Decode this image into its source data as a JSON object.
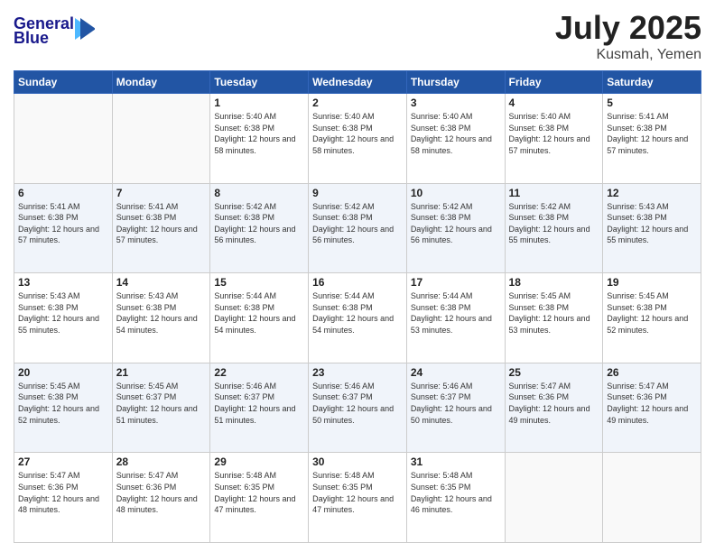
{
  "logo": {
    "line1": "General",
    "line2": "Blue",
    "icon": "▶"
  },
  "title": {
    "month": "July 2025",
    "location": "Kusmah, Yemen"
  },
  "days_of_week": [
    "Sunday",
    "Monday",
    "Tuesday",
    "Wednesday",
    "Thursday",
    "Friday",
    "Saturday"
  ],
  "weeks": [
    [
      {
        "day": "",
        "info": ""
      },
      {
        "day": "",
        "info": ""
      },
      {
        "day": "1",
        "info": "Sunrise: 5:40 AM\nSunset: 6:38 PM\nDaylight: 12 hours and 58 minutes."
      },
      {
        "day": "2",
        "info": "Sunrise: 5:40 AM\nSunset: 6:38 PM\nDaylight: 12 hours and 58 minutes."
      },
      {
        "day": "3",
        "info": "Sunrise: 5:40 AM\nSunset: 6:38 PM\nDaylight: 12 hours and 58 minutes."
      },
      {
        "day": "4",
        "info": "Sunrise: 5:40 AM\nSunset: 6:38 PM\nDaylight: 12 hours and 57 minutes."
      },
      {
        "day": "5",
        "info": "Sunrise: 5:41 AM\nSunset: 6:38 PM\nDaylight: 12 hours and 57 minutes."
      }
    ],
    [
      {
        "day": "6",
        "info": "Sunrise: 5:41 AM\nSunset: 6:38 PM\nDaylight: 12 hours and 57 minutes."
      },
      {
        "day": "7",
        "info": "Sunrise: 5:41 AM\nSunset: 6:38 PM\nDaylight: 12 hours and 57 minutes."
      },
      {
        "day": "8",
        "info": "Sunrise: 5:42 AM\nSunset: 6:38 PM\nDaylight: 12 hours and 56 minutes."
      },
      {
        "day": "9",
        "info": "Sunrise: 5:42 AM\nSunset: 6:38 PM\nDaylight: 12 hours and 56 minutes."
      },
      {
        "day": "10",
        "info": "Sunrise: 5:42 AM\nSunset: 6:38 PM\nDaylight: 12 hours and 56 minutes."
      },
      {
        "day": "11",
        "info": "Sunrise: 5:42 AM\nSunset: 6:38 PM\nDaylight: 12 hours and 55 minutes."
      },
      {
        "day": "12",
        "info": "Sunrise: 5:43 AM\nSunset: 6:38 PM\nDaylight: 12 hours and 55 minutes."
      }
    ],
    [
      {
        "day": "13",
        "info": "Sunrise: 5:43 AM\nSunset: 6:38 PM\nDaylight: 12 hours and 55 minutes."
      },
      {
        "day": "14",
        "info": "Sunrise: 5:43 AM\nSunset: 6:38 PM\nDaylight: 12 hours and 54 minutes."
      },
      {
        "day": "15",
        "info": "Sunrise: 5:44 AM\nSunset: 6:38 PM\nDaylight: 12 hours and 54 minutes."
      },
      {
        "day": "16",
        "info": "Sunrise: 5:44 AM\nSunset: 6:38 PM\nDaylight: 12 hours and 54 minutes."
      },
      {
        "day": "17",
        "info": "Sunrise: 5:44 AM\nSunset: 6:38 PM\nDaylight: 12 hours and 53 minutes."
      },
      {
        "day": "18",
        "info": "Sunrise: 5:45 AM\nSunset: 6:38 PM\nDaylight: 12 hours and 53 minutes."
      },
      {
        "day": "19",
        "info": "Sunrise: 5:45 AM\nSunset: 6:38 PM\nDaylight: 12 hours and 52 minutes."
      }
    ],
    [
      {
        "day": "20",
        "info": "Sunrise: 5:45 AM\nSunset: 6:38 PM\nDaylight: 12 hours and 52 minutes."
      },
      {
        "day": "21",
        "info": "Sunrise: 5:45 AM\nSunset: 6:37 PM\nDaylight: 12 hours and 51 minutes."
      },
      {
        "day": "22",
        "info": "Sunrise: 5:46 AM\nSunset: 6:37 PM\nDaylight: 12 hours and 51 minutes."
      },
      {
        "day": "23",
        "info": "Sunrise: 5:46 AM\nSunset: 6:37 PM\nDaylight: 12 hours and 50 minutes."
      },
      {
        "day": "24",
        "info": "Sunrise: 5:46 AM\nSunset: 6:37 PM\nDaylight: 12 hours and 50 minutes."
      },
      {
        "day": "25",
        "info": "Sunrise: 5:47 AM\nSunset: 6:36 PM\nDaylight: 12 hours and 49 minutes."
      },
      {
        "day": "26",
        "info": "Sunrise: 5:47 AM\nSunset: 6:36 PM\nDaylight: 12 hours and 49 minutes."
      }
    ],
    [
      {
        "day": "27",
        "info": "Sunrise: 5:47 AM\nSunset: 6:36 PM\nDaylight: 12 hours and 48 minutes."
      },
      {
        "day": "28",
        "info": "Sunrise: 5:47 AM\nSunset: 6:36 PM\nDaylight: 12 hours and 48 minutes."
      },
      {
        "day": "29",
        "info": "Sunrise: 5:48 AM\nSunset: 6:35 PM\nDaylight: 12 hours and 47 minutes."
      },
      {
        "day": "30",
        "info": "Sunrise: 5:48 AM\nSunset: 6:35 PM\nDaylight: 12 hours and 47 minutes."
      },
      {
        "day": "31",
        "info": "Sunrise: 5:48 AM\nSunset: 6:35 PM\nDaylight: 12 hours and 46 minutes."
      },
      {
        "day": "",
        "info": ""
      },
      {
        "day": "",
        "info": ""
      }
    ]
  ]
}
